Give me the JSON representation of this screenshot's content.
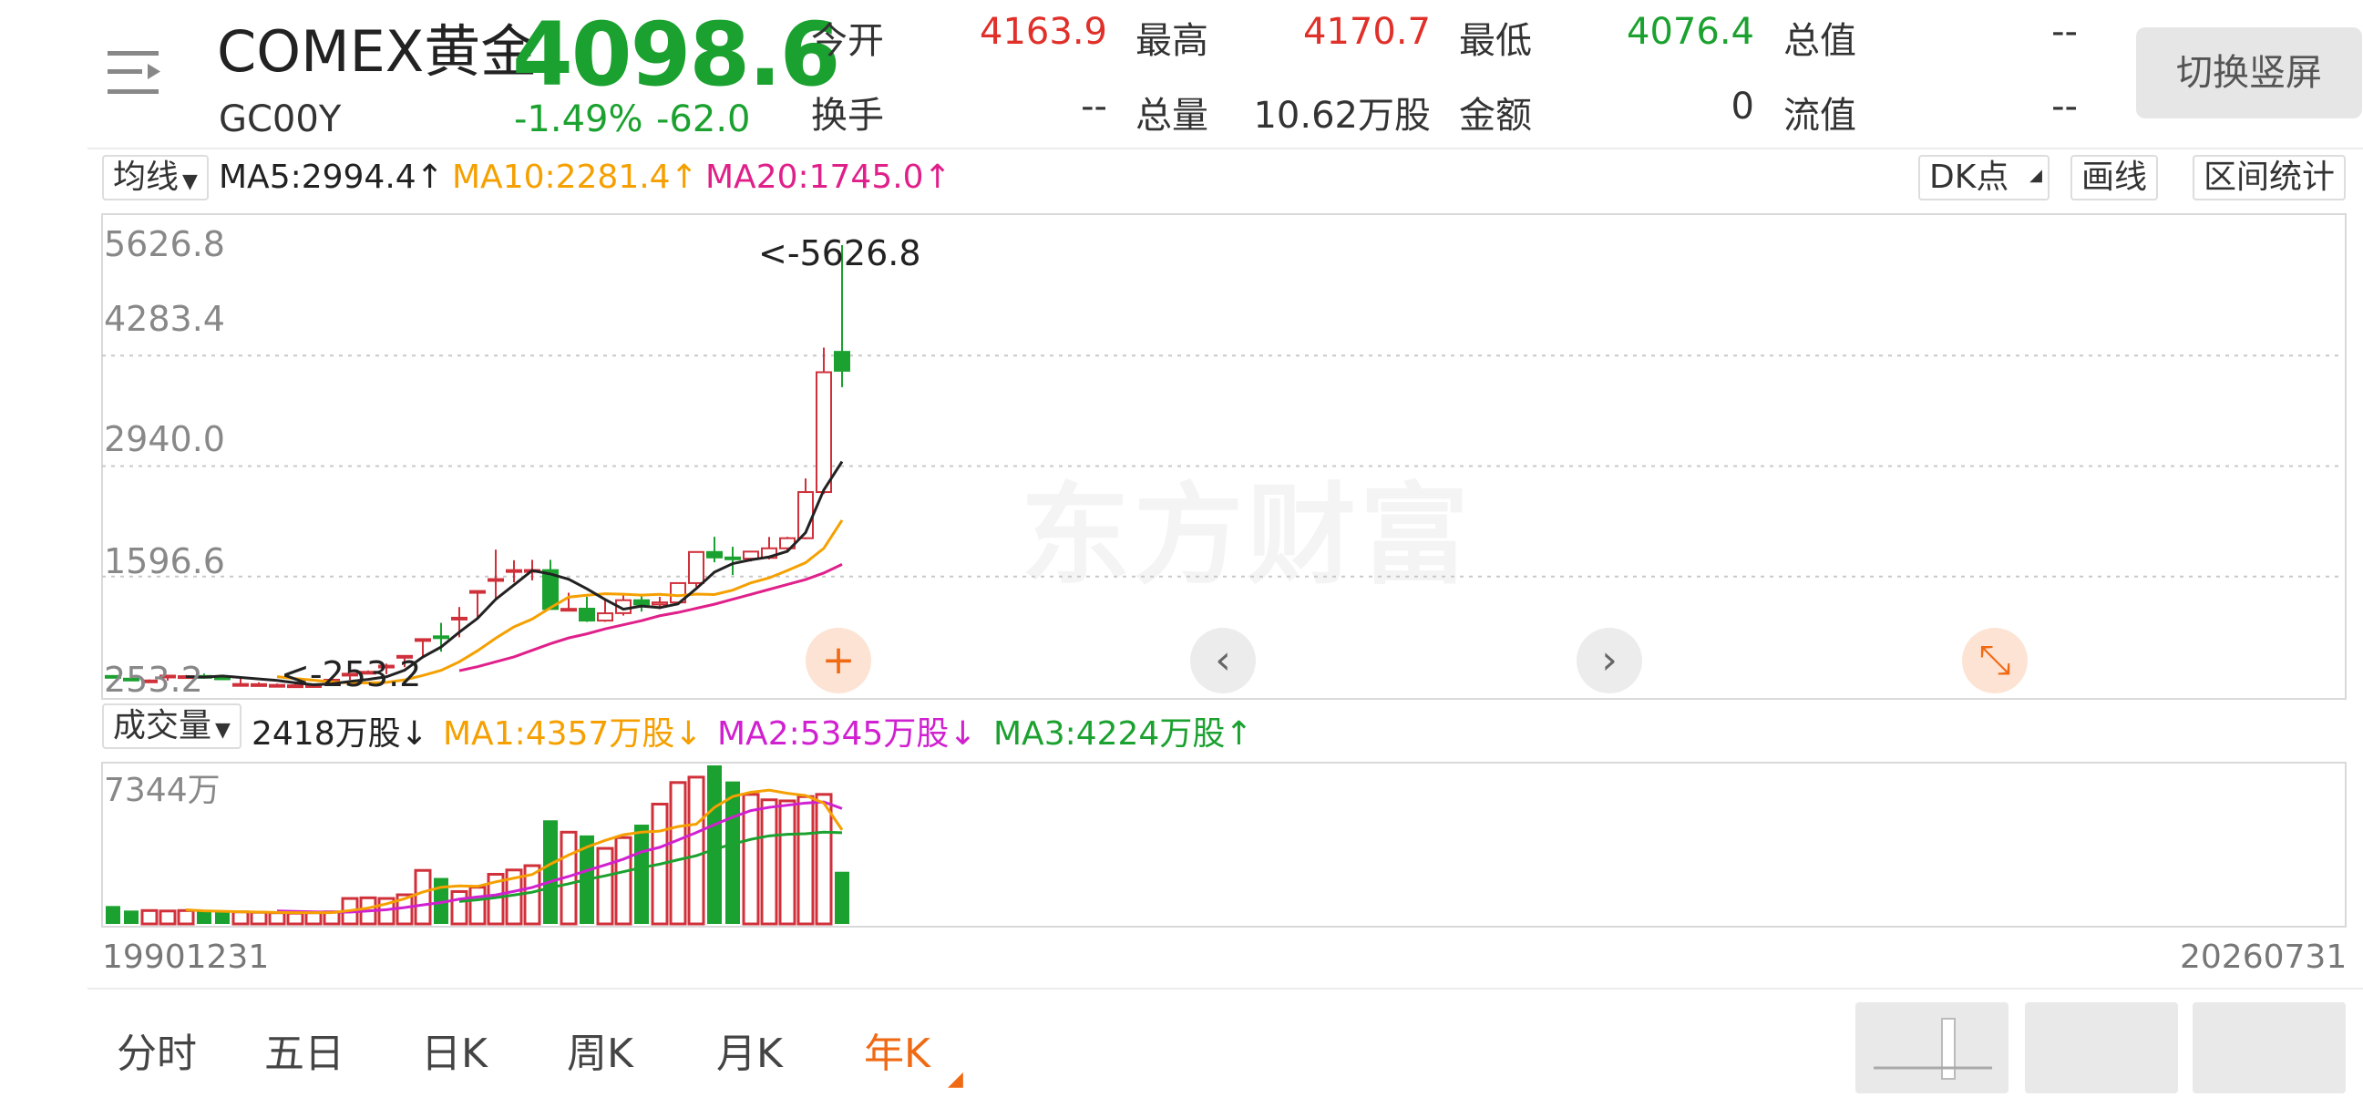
{
  "header": {
    "name": "COMEX黄金",
    "code": "GC00Y",
    "price": "4098.6",
    "change_pct": "-1.49%",
    "change": "-62.0",
    "switch_label": "切换竖屏",
    "stats": [
      {
        "label": "今开",
        "value": "4163.9",
        "color": "#e0302a"
      },
      {
        "label": "最高",
        "value": "4170.7",
        "color": "#e0302a"
      },
      {
        "label": "最低",
        "value": "4076.4",
        "color": "#1ba12f"
      },
      {
        "label": "总值",
        "value": "--",
        "color": "#333333"
      },
      {
        "label": "换手",
        "value": "--",
        "color": "#333333"
      },
      {
        "label": "总量",
        "value": "10.62万股",
        "color": "#333333"
      },
      {
        "label": "金额",
        "value": "0",
        "color": "#333333"
      },
      {
        "label": "流值",
        "value": "--",
        "color": "#333333"
      }
    ]
  },
  "ma_bar": {
    "selector": "均线",
    "ma5": "MA5:2994.4↑",
    "ma10": "MA10:2281.4↑",
    "ma20": "MA20:1745.0↑",
    "colors": {
      "ma5": "#222222",
      "ma10": "#f5a000",
      "ma20": "#e0208a"
    },
    "dk_label": "DK点",
    "draw_label": "画线",
    "stats_label": "区间统计"
  },
  "kline": {
    "axis_labels": [
      "5626.8",
      "4283.4",
      "2940.0",
      "1596.6",
      "253.2"
    ],
    "max_marker": "<-5626.8",
    "min_marker": "<-253.2",
    "watermark": "东方财富",
    "controls": [
      {
        "name": "zoom-in-icon",
        "glyph": "+"
      },
      {
        "name": "chevron-left-icon",
        "glyph": "‹"
      },
      {
        "name": "chevron-right-icon",
        "glyph": "›"
      },
      {
        "name": "collapse-icon",
        "glyph": "⤡"
      }
    ]
  },
  "volume_bar": {
    "selector": "成交量",
    "current": "2418万股↓",
    "ma1": "MA1:4357万股↓",
    "ma2": "MA2:5345万股↓",
    "ma3": "MA3:4224万股↑",
    "colors": {
      "ma1": "#f5a000",
      "ma2": "#d020d0",
      "ma3": "#1ba12f"
    },
    "axis_max": "7344万"
  },
  "dates": {
    "start": "19901231",
    "end": "20260731"
  },
  "tabs": [
    {
      "label": "分时",
      "active": false
    },
    {
      "label": "五日",
      "active": false
    },
    {
      "label": "日K",
      "active": false
    },
    {
      "label": "周K",
      "active": false
    },
    {
      "label": "月K",
      "active": false
    },
    {
      "label": "年K",
      "active": true
    }
  ],
  "colors": {
    "up": "#d0303a",
    "down": "#1ba12f",
    "accent": "#f06a14"
  },
  "chart_data": {
    "type": "candlestick",
    "series": [
      {
        "open": 388,
        "high": 392,
        "low": 365,
        "close": 386,
        "volume": 830
      },
      {
        "open": 355,
        "high": 370,
        "low": 340,
        "close": 353,
        "volume": 620
      },
      {
        "open": 333,
        "high": 345,
        "low": 325,
        "close": 333,
        "volume": 620
      },
      {
        "open": 392,
        "high": 398,
        "low": 330,
        "close": 392,
        "volume": 600
      },
      {
        "open": 384,
        "high": 399,
        "low": 370,
        "close": 385,
        "volume": 620
      },
      {
        "open": 388,
        "high": 417,
        "low": 380,
        "close": 387,
        "volume": 600
      },
      {
        "open": 370,
        "high": 396,
        "low": 355,
        "close": 369,
        "volume": 580
      },
      {
        "open": 290,
        "high": 370,
        "low": 275,
        "close": 290,
        "volume": 560
      },
      {
        "open": 287,
        "high": 310,
        "low": 270,
        "close": 288,
        "volume": 540
      },
      {
        "open": 279,
        "high": 295,
        "low": 255,
        "close": 279,
        "volume": 520
      },
      {
        "open": 272,
        "high": 290,
        "low": 265,
        "close": 274,
        "volume": 500
      },
      {
        "open": 276,
        "high": 292,
        "low": 260,
        "close": 276,
        "volume": 520
      },
      {
        "open": 342,
        "high": 351,
        "low": 275,
        "close": 342,
        "volume": 560
      },
      {
        "open": 415,
        "high": 425,
        "low": 340,
        "close": 415,
        "volume": 1180
      },
      {
        "open": 438,
        "high": 455,
        "low": 408,
        "close": 438,
        "volume": 1210
      },
      {
        "open": 513,
        "high": 538,
        "low": 410,
        "close": 513,
        "volume": 1180
      },
      {
        "open": 632,
        "high": 640,
        "low": 495,
        "close": 632,
        "volume": 1350
      },
      {
        "open": 836,
        "high": 841,
        "low": 605,
        "close": 836,
        "volume": 2480
      },
      {
        "open": 870,
        "high": 1034,
        "low": 683,
        "close": 869,
        "volume": 2130
      },
      {
        "open": 1096,
        "high": 1226,
        "low": 858,
        "close": 1096,
        "volume": 1500
      },
      {
        "open": 1421,
        "high": 1425,
        "low": 1076,
        "close": 1421,
        "volume": 1700
      },
      {
        "open": 1565,
        "high": 1924,
        "low": 1320,
        "close": 1566,
        "volume": 2300
      },
      {
        "open": 1675,
        "high": 1795,
        "low": 1526,
        "close": 1675,
        "volume": 2500
      },
      {
        "open": 1675,
        "high": 1800,
        "low": 1550,
        "close": 1676,
        "volume": 2700
      },
      {
        "open": 1675,
        "high": 1800,
        "low": 1525,
        "close": 1202,
        "volume": 4800
      },
      {
        "open": 1202,
        "high": 1400,
        "low": 1180,
        "close": 1204,
        "volume": 4250
      },
      {
        "open": 1206,
        "high": 1350,
        "low": 1045,
        "close": 1061,
        "volume": 4100
      },
      {
        "open": 1061,
        "high": 1310,
        "low": 1046,
        "close": 1150,
        "volume": 3500
      },
      {
        "open": 1152,
        "high": 1376,
        "low": 1122,
        "close": 1309,
        "volume": 4000
      },
      {
        "open": 1309,
        "high": 1365,
        "low": 1170,
        "close": 1257,
        "volume": 4600
      },
      {
        "open": 1257,
        "high": 1350,
        "low": 1200,
        "close": 1282,
        "volume": 5550
      },
      {
        "open": 1282,
        "high": 1524,
        "low": 1275,
        "close": 1517,
        "volume": 6550
      },
      {
        "open": 1517,
        "high": 1795,
        "low": 1470,
        "close": 1895,
        "volume": 6800
      },
      {
        "open": 1895,
        "high": 2080,
        "low": 1770,
        "close": 1829,
        "volume": 7344
      },
      {
        "open": 1829,
        "high": 1959,
        "low": 1615,
        "close": 1814,
        "volume": 6600
      },
      {
        "open": 1814,
        "high": 1880,
        "low": 1780,
        "close": 1900,
        "volume": 6000
      },
      {
        "open": 1824,
        "high": 2078,
        "low": 1805,
        "close": 1940,
        "volume": 5750
      },
      {
        "open": 1940,
        "high": 2080,
        "low": 1890,
        "close": 2063,
        "volume": 5700
      },
      {
        "open": 2063,
        "high": 2790,
        "low": 2050,
        "close": 2624,
        "volume": 5900
      },
      {
        "open": 2624,
        "high": 4381,
        "low": 2600,
        "close": 4081,
        "volume": 6000
      },
      {
        "open": 4329,
        "high": 5627,
        "low": 3900,
        "close": 4099,
        "volume": 2418
      }
    ],
    "ma5": [
      null,
      null,
      null,
      null,
      379,
      374,
      387,
      370,
      351,
      333,
      305,
      281,
      292,
      321,
      346,
      378,
      458,
      618,
      740,
      920,
      1088,
      1320,
      1495,
      1670,
      1628,
      1564,
      1448,
      1318,
      1200,
      1238,
      1218,
      1265,
      1450,
      1650,
      1754,
      1800,
      1835,
      1904,
      2131,
      2650,
      2994.4
    ],
    "ma10": [
      null,
      null,
      null,
      null,
      null,
      null,
      null,
      null,
      null,
      379,
      356,
      336,
      315,
      303,
      303,
      310,
      340,
      394,
      456,
      560,
      694,
      847,
      985,
      1080,
      1217,
      1346,
      1370,
      1388,
      1382,
      1371,
      1380,
      1364,
      1383,
      1378,
      1431,
      1520,
      1580,
      1670,
      1765,
      1940,
      2281.4
    ],
    "ma20": [
      null,
      null,
      null,
      null,
      null,
      null,
      null,
      null,
      null,
      null,
      null,
      null,
      null,
      null,
      null,
      null,
      null,
      null,
      null,
      452,
      500,
      560,
      620,
      700,
      780,
      850,
      900,
      960,
      1010,
      1060,
      1120,
      1160,
      1210,
      1260,
      1320,
      1380,
      1440,
      1500,
      1560,
      1640,
      1745.0
    ],
    "vol_ma1": [
      null,
      null,
      null,
      null,
      654,
      608,
      584,
      566,
      550,
      532,
      520,
      520,
      520,
      620,
      735,
      930,
      1170,
      1480,
      1700,
      1760,
      1740,
      1950,
      2120,
      2290,
      2770,
      3190,
      3560,
      3870,
      4130,
      4250,
      4300,
      4510,
      4620,
      5400,
      5900,
      6100,
      6200,
      6050,
      5950,
      5600,
      4357
    ],
    "vol_ma2": [
      null,
      null,
      null,
      null,
      null,
      null,
      null,
      null,
      null,
      600,
      580,
      560,
      545,
      550,
      600,
      660,
      760,
      880,
      990,
      1150,
      1250,
      1340,
      1510,
      1690,
      1960,
      2200,
      2470,
      2730,
      3000,
      3340,
      3550,
      3890,
      4230,
      4600,
      4950,
      5250,
      5400,
      5500,
      5600,
      5650,
      5345
    ],
    "vol_ma3": [
      null,
      null,
      null,
      null,
      null,
      null,
      null,
      null,
      null,
      null,
      null,
      null,
      null,
      null,
      null,
      null,
      null,
      null,
      null,
      1040,
      1120,
      1220,
      1340,
      1470,
      1680,
      1860,
      2060,
      2230,
      2420,
      2610,
      2770,
      2970,
      3160,
      3460,
      3700,
      3920,
      4080,
      4150,
      4180,
      4250,
      4224
    ],
    "y_range": [
      253.2,
      5626.8
    ],
    "volume_max": 7344,
    "x_range": [
      "19901231",
      "20260731"
    ]
  }
}
